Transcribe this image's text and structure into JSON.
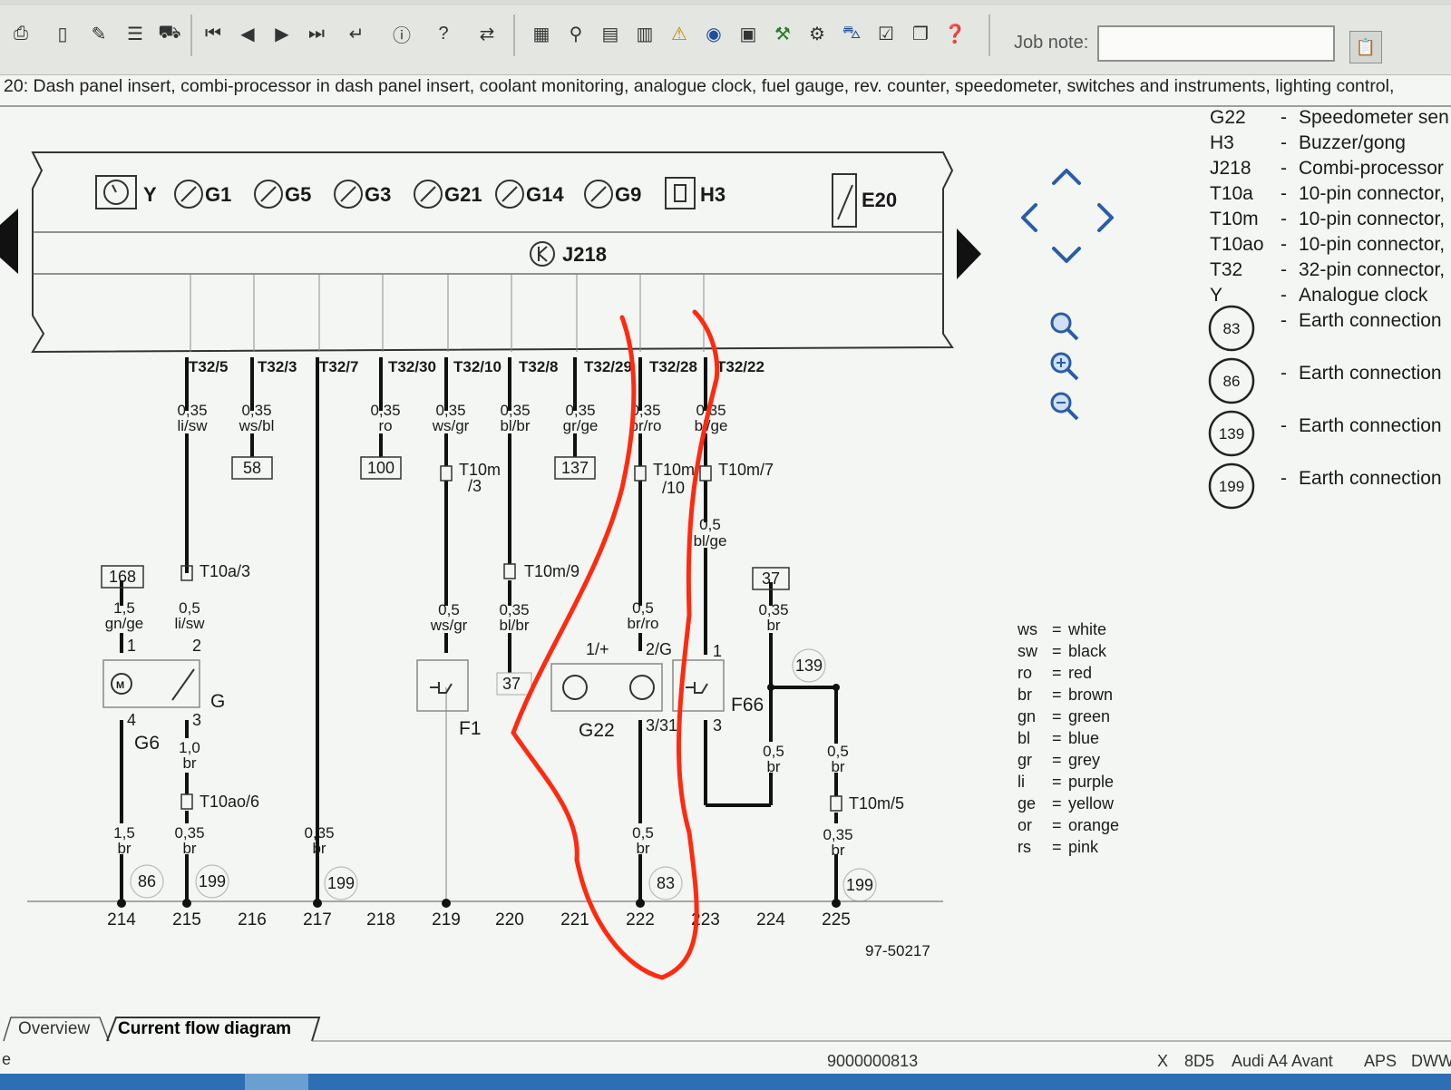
{
  "toolbar": {
    "job_note_label": "Job note:",
    "job_note_value": ""
  },
  "header": {
    "text": "20: Dash panel insert, combi-processor in dash panel insert, coolant monitoring, analogue clock, fuel gauge, rev. counter, speedometer, switches and instruments, lighting control,"
  },
  "components": {
    "top": [
      "Y",
      "G1",
      "G5",
      "G3",
      "G21",
      "G14",
      "G9",
      "H3",
      "E20"
    ],
    "processor": "J218"
  },
  "pins": [
    "T32/5",
    "T32/3",
    "T32/7",
    "T32/30",
    "T32/10",
    "T32/8",
    "T32/29",
    "T32/28",
    "T32/22"
  ],
  "wires": [
    {
      "size": "0,35",
      "color": "li/sw"
    },
    {
      "size": "0,35",
      "color": "ws/bl"
    },
    {
      "size": "0,35",
      "color": "ro"
    },
    {
      "size": "0,35",
      "color": "ws/gr"
    },
    {
      "size": "0,35",
      "color": "bl/br"
    },
    {
      "size": "0,35",
      "color": "gr/ge"
    },
    {
      "size": "0,35",
      "color": "br/ro"
    },
    {
      "size": "0,35",
      "color": "bl/ge"
    }
  ],
  "refs": [
    "58",
    "100",
    "137",
    "168",
    "37",
    "37"
  ],
  "connectors": [
    "T10m",
    "/3",
    "T10m",
    "/10",
    "T10m/7",
    "T10a/3",
    "T10m/9",
    "T10ao/6",
    "T10m/5"
  ],
  "lower_wires": [
    {
      "size": "1,5",
      "color": "gn/ge"
    },
    {
      "size": "0,5",
      "color": "li/sw"
    },
    {
      "size": "0,5",
      "color": "ws/gr"
    },
    {
      "size": "0,35",
      "color": "bl/br"
    },
    {
      "size": "0,5",
      "color": "br/ro"
    },
    {
      "size": "0,5",
      "color": "bl/ge"
    },
    {
      "size": "0,35",
      "color": "br"
    },
    {
      "size": "1,0",
      "color": "br"
    },
    {
      "size": "0,5",
      "color": "br"
    },
    {
      "size": "0,5",
      "color": "br"
    },
    {
      "size": "1,5",
      "color": "br"
    },
    {
      "size": "0,35",
      "color": "br"
    },
    {
      "size": "0,35",
      "color": "br"
    },
    {
      "size": "0,5",
      "color": "br"
    },
    {
      "size": "0,35",
      "color": "br"
    }
  ],
  "pin_numbers": [
    "1",
    "2",
    "4",
    "3",
    "1/+",
    "2/G",
    "3/31",
    "1",
    "3"
  ],
  "lower_components": [
    "G",
    "G6",
    "F1",
    "G22",
    "F66"
  ],
  "earth_points": [
    "86",
    "199",
    "199",
    "83",
    "199",
    "139"
  ],
  "tracks": [
    "214",
    "215",
    "216",
    "217",
    "218",
    "219",
    "220",
    "221",
    "222",
    "223",
    "224",
    "225"
  ],
  "diagram_id": "97-50217",
  "legend": [
    {
      "code": "G22",
      "desc": "Speedometer sen"
    },
    {
      "code": "H3",
      "desc": "Buzzer/gong"
    },
    {
      "code": "J218",
      "desc": "Combi-processor"
    },
    {
      "code": "T10a",
      "desc": "10-pin connector,"
    },
    {
      "code": "T10m",
      "desc": "10-pin connector,"
    },
    {
      "code": "T10ao",
      "desc": "10-pin connector,"
    },
    {
      "code": "T32",
      "desc": "32-pin connector,"
    },
    {
      "code": "Y",
      "desc": "Analogue clock"
    }
  ],
  "earth_legend": [
    {
      "num": "83",
      "desc": "Earth connection"
    },
    {
      "num": "86",
      "desc": "Earth connection"
    },
    {
      "num": "139",
      "desc": "Earth connection"
    },
    {
      "num": "199",
      "desc": "Earth connection"
    }
  ],
  "color_codes": [
    {
      "code": "ws",
      "name": "white"
    },
    {
      "code": "sw",
      "name": "black"
    },
    {
      "code": "ro",
      "name": "red"
    },
    {
      "code": "br",
      "name": "brown"
    },
    {
      "code": "gn",
      "name": "green"
    },
    {
      "code": "bl",
      "name": "blue"
    },
    {
      "code": "gr",
      "name": "grey"
    },
    {
      "code": "li",
      "name": "purple"
    },
    {
      "code": "ge",
      "name": "yellow"
    },
    {
      "code": "or",
      "name": "orange"
    },
    {
      "code": "rs",
      "name": "pink"
    }
  ],
  "tabs": [
    "Overview",
    "Current flow diagram"
  ],
  "status": {
    "left": "e",
    "number": "9000000813",
    "x": "X",
    "code": "8D5",
    "vehicle": "Audi A4 Avant",
    "aps": "APS",
    "dw": "DWW"
  },
  "colors": {
    "annotation": "#ff2a10",
    "wire": "#111111",
    "taskbar": "#2d6fb3"
  }
}
